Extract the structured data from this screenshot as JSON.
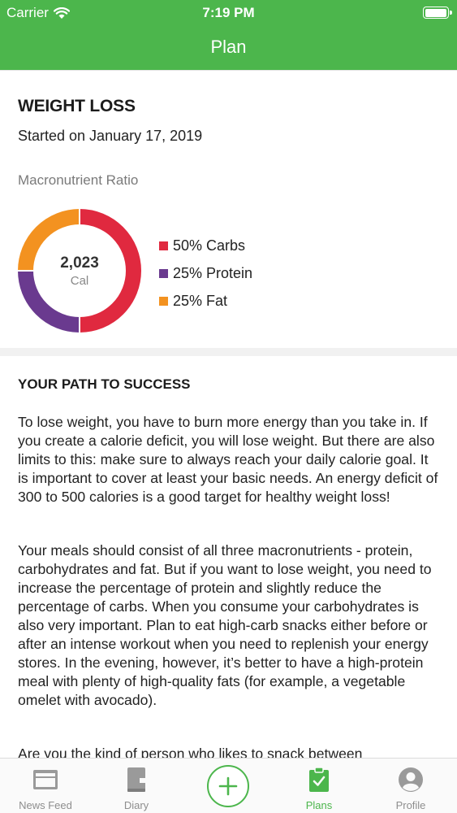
{
  "status_bar": {
    "carrier": "Carrier",
    "time": "7:19 PM",
    "battery_level": 1.0
  },
  "nav": {
    "title": "Plan"
  },
  "plan": {
    "title": "WEIGHT LOSS",
    "started": "Started on January 17, 2019",
    "macro_label": "Macronutrient Ratio",
    "calories": "2,023",
    "calories_unit": "Cal",
    "macros": [
      {
        "label": "50% Carbs",
        "percent": 50,
        "color": "#e0293f"
      },
      {
        "label": "25% Protein",
        "percent": 25,
        "color": "#6a3a8f"
      },
      {
        "label": "25% Fat",
        "percent": 25,
        "color": "#f39220"
      }
    ]
  },
  "content": {
    "section_title": "YOUR PATH TO SUCCESS",
    "paragraphs": [
      "To lose weight, you have to burn more energy than you take in. If you create a calorie deficit, you will lose weight. But there are also limits to this: make sure to always reach your daily calorie goal. It is important to cover at least your basic needs. An energy deficit of 300 to 500 calories is a good target for healthy weight loss!",
      "Your meals should consist of all three macronutrients - protein, carbohydrates and fat. But if you want to lose weight, you need to increase the percentage of protein and slightly reduce the percentage of carbs. When you consume your carbohydrates is also very important. Plan to eat high-carb snacks either before or after an intense workout when you need to replenish your energy stores. In the evening, however, it’s better to have a high-protein meal with plenty of high-quality fats (for example, a vegetable omelet with avocado).",
      "Are you the kind of person who likes to snack between"
    ]
  },
  "tabs": [
    {
      "label": "News Feed",
      "icon": "news-feed-icon",
      "active": false
    },
    {
      "label": "Diary",
      "icon": "diary-icon",
      "active": false
    },
    {
      "label": "",
      "icon": "plus-icon",
      "active": false
    },
    {
      "label": "Plans",
      "icon": "clipboard-check-icon",
      "active": true
    },
    {
      "label": "Profile",
      "icon": "profile-icon",
      "active": false
    }
  ],
  "colors": {
    "brand": "#4cb64c",
    "inactive_tab": "#8e8e8e"
  }
}
